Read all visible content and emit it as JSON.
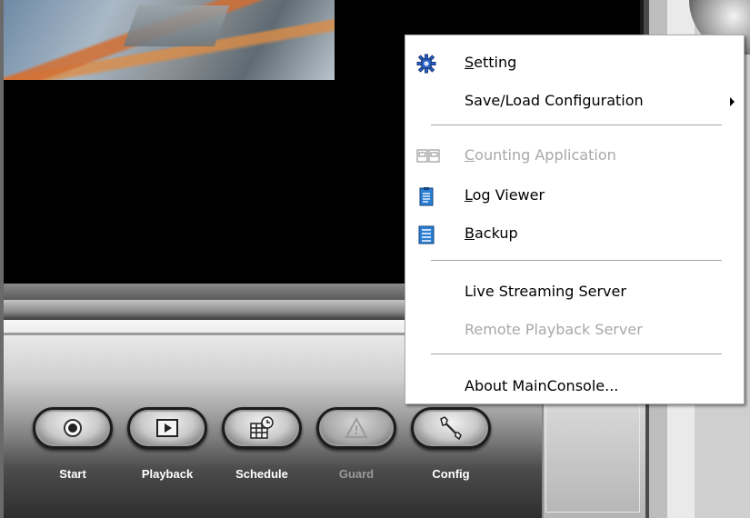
{
  "context_menu": {
    "items": [
      {
        "label": "Setting",
        "accel": "S",
        "rest": "etting",
        "icon": "gear-icon",
        "enabled": true
      },
      {
        "label": "Save/Load Configuration",
        "icon": "",
        "enabled": true,
        "submenu": true
      },
      {
        "label": "Counting Application",
        "accel": "C",
        "rest": "ounting Application",
        "icon": "counter-icon",
        "enabled": false
      },
      {
        "label": "Log Viewer",
        "accel": "L",
        "rest": "og Viewer",
        "icon": "clipboard-icon",
        "enabled": true
      },
      {
        "label": "Backup",
        "accel": "B",
        "rest": "ackup",
        "icon": "list-icon",
        "enabled": true
      },
      {
        "label": "Live Streaming Server",
        "icon": "",
        "enabled": true
      },
      {
        "label": "Remote Playback Server",
        "icon": "",
        "enabled": false
      },
      {
        "label": "About MainConsole...",
        "icon": "",
        "enabled": true
      }
    ]
  },
  "toolbar": {
    "buttons": [
      {
        "label": "Start",
        "icon": "record-icon",
        "enabled": true
      },
      {
        "label": "Playback",
        "icon": "play-icon",
        "enabled": true
      },
      {
        "label": "Schedule",
        "icon": "schedule-icon",
        "enabled": true
      },
      {
        "label": "Guard",
        "icon": "warning-icon",
        "enabled": false
      },
      {
        "label": "Config",
        "icon": "wrench-icon",
        "enabled": true
      }
    ]
  },
  "colors": {
    "menu_bg": "#ffffff",
    "menu_disabled_text": "#a8a8a8",
    "toolbar_label": "#ffffff",
    "video_bg": "#000000"
  }
}
